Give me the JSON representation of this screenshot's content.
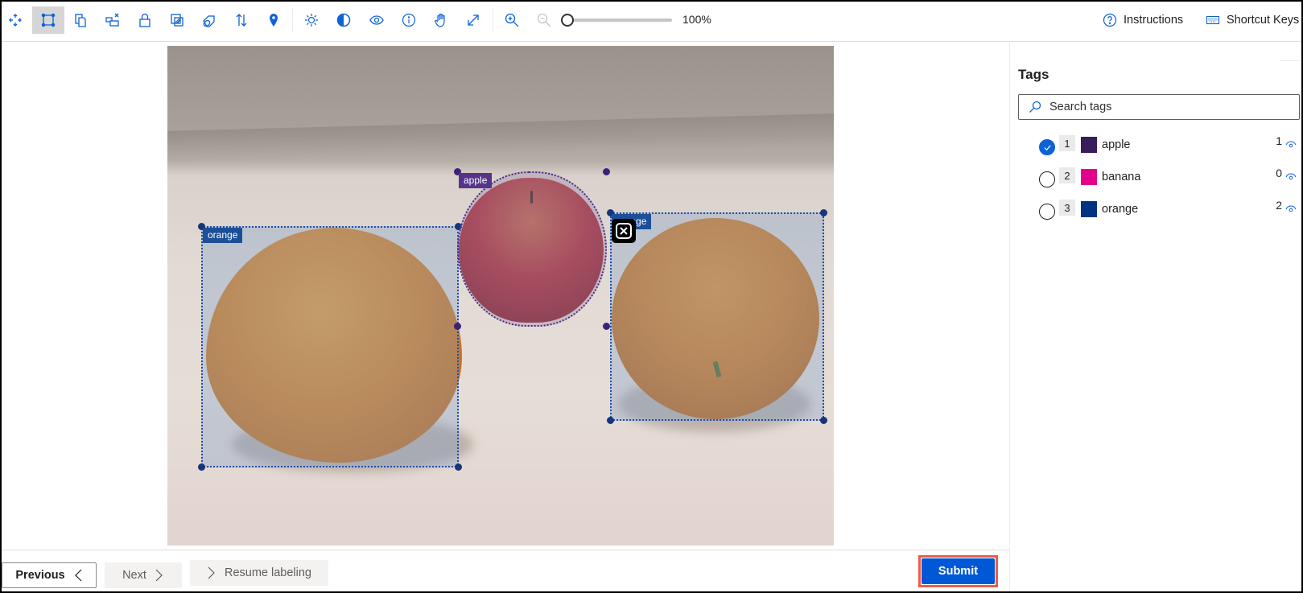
{
  "toolbar": {
    "tools": [
      {
        "name": "move-tool",
        "icon": "move-arrows-icon",
        "active": false
      },
      {
        "name": "rectangle-tool",
        "icon": "bounding-box-icon",
        "active": true
      },
      {
        "name": "copy-tool",
        "icon": "copy-icon",
        "active": false
      },
      {
        "name": "remove-region-tool",
        "icon": "remove-region-icon",
        "active": false
      },
      {
        "name": "lock-tool",
        "icon": "lock-icon",
        "active": false
      },
      {
        "name": "select-region-tool",
        "icon": "overlap-icon",
        "active": false
      },
      {
        "name": "erase-tag-tool",
        "icon": "eraser-icon",
        "active": false
      },
      {
        "name": "sort-tool",
        "icon": "sort-arrows-icon",
        "active": false
      },
      {
        "name": "pin-tool",
        "icon": "map-pin-icon",
        "active": false
      },
      {
        "name": "brightness-tool",
        "icon": "sun-icon",
        "active": false
      },
      {
        "name": "contrast-tool",
        "icon": "contrast-icon",
        "active": false
      },
      {
        "name": "visibility-tool",
        "icon": "eye-icon",
        "active": false
      },
      {
        "name": "info-tool",
        "icon": "info-icon",
        "active": false
      },
      {
        "name": "pan-tool",
        "icon": "hand-icon",
        "active": false
      },
      {
        "name": "fit-tool",
        "icon": "expand-icon",
        "active": false
      },
      {
        "name": "zoom-in-tool",
        "icon": "zoom-in-icon",
        "active": false
      },
      {
        "name": "zoom-out-tool",
        "icon": "zoom-out-icon",
        "active": false,
        "disabled": true
      }
    ],
    "zoom_level": "100%",
    "zoom_slider_fraction": 0,
    "instructions_label": "Instructions",
    "shortcut_keys_label": "Shortcut Keys"
  },
  "canvas": {
    "regions": [
      {
        "tag": "orange",
        "color": "#1c4f96"
      },
      {
        "tag": "apple",
        "color": "#55358a"
      },
      {
        "tag": "orange",
        "color": "#1c4f96"
      }
    ],
    "delete_region_icon": "close-box-icon"
  },
  "footer": {
    "previous_label": "Previous",
    "next_label": "Next",
    "resume_label": "Resume labeling",
    "submit_label": "Submit"
  },
  "sidebar": {
    "title": "Tags",
    "search_placeholder": "Search tags",
    "search_value": "",
    "tags": [
      {
        "index": "1",
        "name": "apple",
        "color": "#3a1c5c",
        "count": "1",
        "selected": true
      },
      {
        "index": "2",
        "name": "banana",
        "color": "#e3008c",
        "count": "0",
        "selected": false
      },
      {
        "index": "3",
        "name": "orange",
        "color": "#003482",
        "count": "2",
        "selected": false
      }
    ]
  }
}
